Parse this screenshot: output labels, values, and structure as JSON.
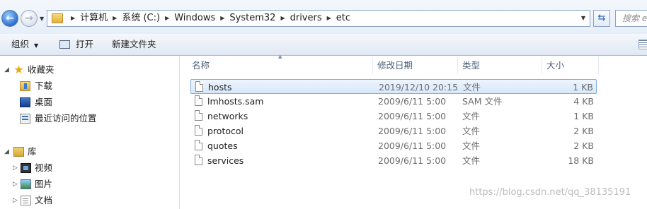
{
  "nav": {
    "back_glyph": "←",
    "forward_glyph": "→"
  },
  "address": {
    "crumbs": [
      "计算机",
      "系统 (C:)",
      "Windows",
      "System32",
      "drivers",
      "etc"
    ]
  },
  "search": {
    "placeholder": "搜索 etc"
  },
  "toolbar": {
    "organize": "组织",
    "open": "打开",
    "new_folder": "新建文件夹"
  },
  "sidebar": {
    "items": [
      {
        "label": "收藏夹",
        "icon": "star-icon",
        "level": 0
      },
      {
        "label": "下载",
        "icon": "downloads-folder-icon",
        "level": 1
      },
      {
        "label": "桌面",
        "icon": "desktop-icon",
        "level": 1
      },
      {
        "label": "最近访问的位置",
        "icon": "recent-places-icon",
        "level": 1
      },
      {
        "label": "库",
        "icon": "libraries-icon",
        "level": 0
      },
      {
        "label": "视频",
        "icon": "videos-icon",
        "level": 1
      },
      {
        "label": "图片",
        "icon": "pictures-icon",
        "level": 1
      },
      {
        "label": "文档",
        "icon": "documents-icon",
        "level": 1
      }
    ]
  },
  "columns": {
    "name": "名称",
    "modified": "修改日期",
    "type": "类型",
    "size": "大小"
  },
  "files": [
    {
      "name": "hosts",
      "modified": "2019/12/10 20:15",
      "type": "文件",
      "size": "1 KB",
      "selected": true
    },
    {
      "name": "lmhosts.sam",
      "modified": "2009/6/11 5:00",
      "type": "SAM 文件",
      "size": "4 KB",
      "selected": false
    },
    {
      "name": "networks",
      "modified": "2009/6/11 5:00",
      "type": "文件",
      "size": "1 KB",
      "selected": false
    },
    {
      "name": "protocol",
      "modified": "2009/6/11 5:00",
      "type": "文件",
      "size": "2 KB",
      "selected": false
    },
    {
      "name": "quotes",
      "modified": "2009/6/11 5:00",
      "type": "文件",
      "size": "2 KB",
      "selected": false
    },
    {
      "name": "services",
      "modified": "2009/6/11 5:00",
      "type": "文件",
      "size": "18 KB",
      "selected": false
    }
  ],
  "watermark": "https://blog.csdn.net/qq_38135191"
}
